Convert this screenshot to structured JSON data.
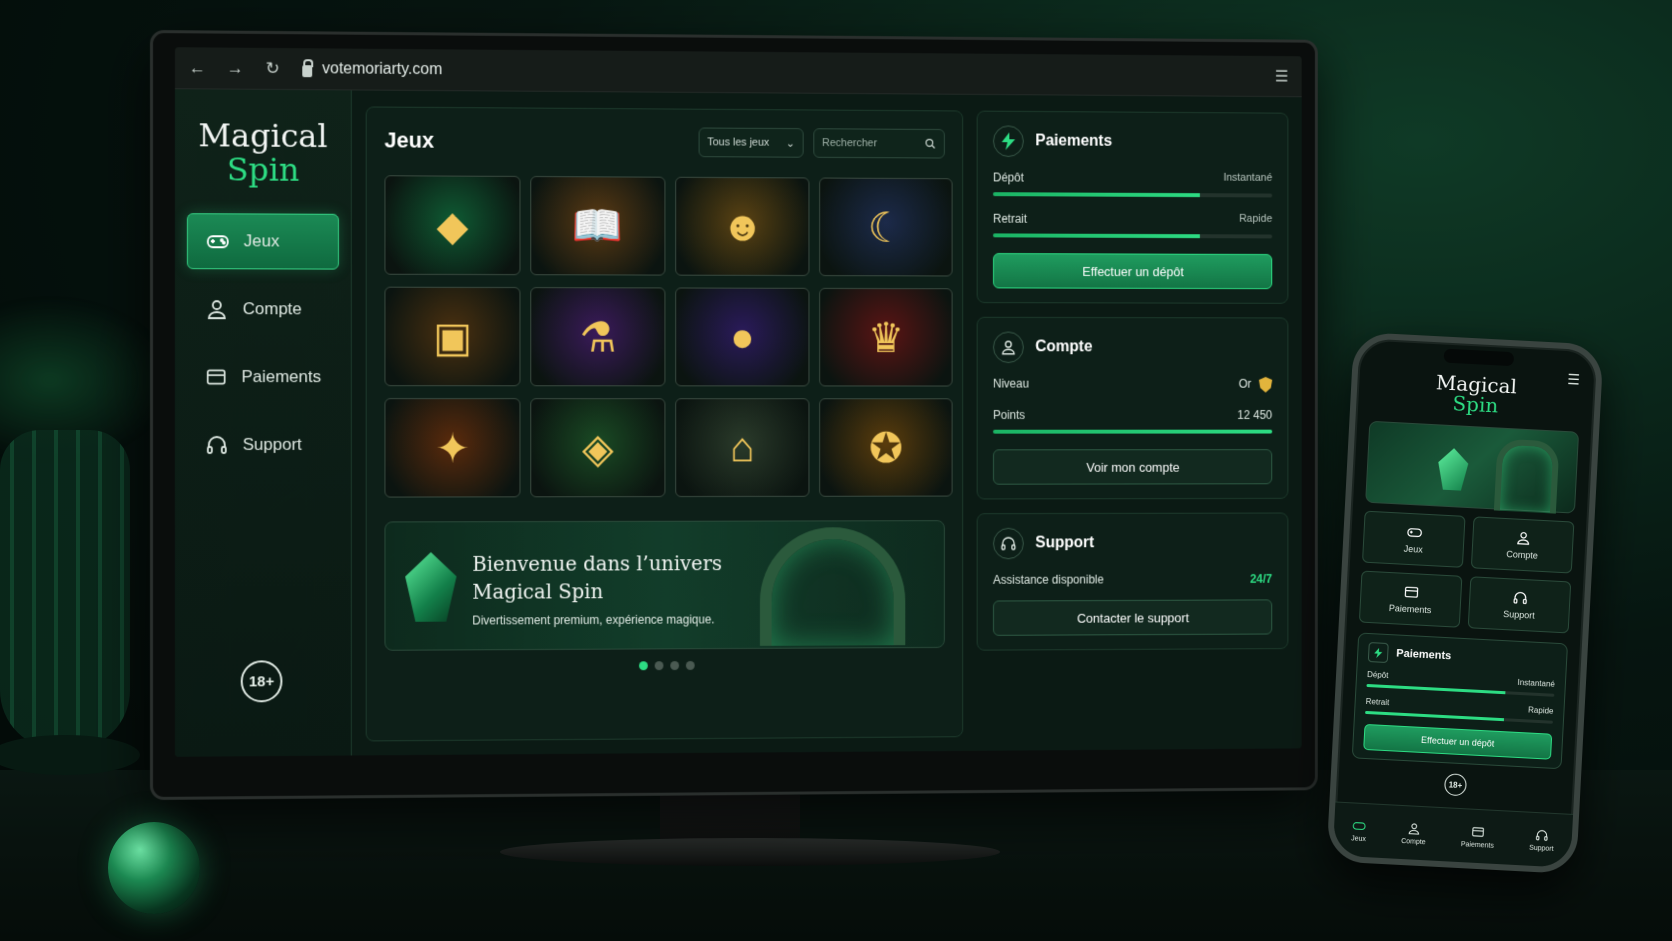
{
  "browser": {
    "url": "votemoriarty.com"
  },
  "logo": {
    "line1": "Magical",
    "line2": "Spin"
  },
  "sidebar": {
    "items": [
      {
        "label": "Jeux",
        "icon": "gamepad-icon",
        "active": true
      },
      {
        "label": "Compte",
        "icon": "user-icon",
        "active": false
      },
      {
        "label": "Paiements",
        "icon": "wallet-icon",
        "active": false
      },
      {
        "label": "Support",
        "icon": "headset-icon",
        "active": false
      }
    ],
    "age_badge": "18+"
  },
  "games": {
    "title": "Jeux",
    "filter_value": "Tous les jeux",
    "search_placeholder": "Rechercher",
    "tiles": [
      {
        "name": "emerald",
        "icon": "emerald-icon",
        "color": "#0f5a33"
      },
      {
        "name": "spellbook",
        "icon": "book-icon",
        "color": "#5a3a14"
      },
      {
        "name": "golden-mask",
        "icon": "mask-icon",
        "color": "#5a4212"
      },
      {
        "name": "wolf-moon",
        "icon": "wolf-icon",
        "color": "#1c2a4a"
      },
      {
        "name": "treasure-chest",
        "icon": "chest-icon",
        "color": "#4a3010"
      },
      {
        "name": "potion",
        "icon": "potion-icon",
        "color": "#3a1a5a"
      },
      {
        "name": "crystal-ball",
        "icon": "crystal-ball-icon",
        "color": "#2a1a5a"
      },
      {
        "name": "crown",
        "icon": "crown-icon",
        "color": "#5a1414"
      },
      {
        "name": "phoenix",
        "icon": "phoenix-icon",
        "color": "#5a2a0c"
      },
      {
        "name": "amulet",
        "icon": "amulet-icon",
        "color": "#1a4a24"
      },
      {
        "name": "temple",
        "icon": "temple-icon",
        "color": "#2a3a2a"
      },
      {
        "name": "gold-pile",
        "icon": "gold-icon",
        "color": "#5a3c0c"
      }
    ]
  },
  "banner": {
    "title_line1": "Bienvenue dans l’univers",
    "title_line2": "Magical Spin",
    "subtitle": "Divertissement premium, expérience magique.",
    "active_dot": 0,
    "dot_count": 4
  },
  "payments_card": {
    "title": "Paiements",
    "deposit_label": "Dépôt",
    "deposit_value": "Instantané",
    "deposit_progress": 0.74,
    "withdraw_label": "Retrait",
    "withdraw_value": "Rapide",
    "withdraw_progress": 0.74,
    "button": "Effectuer un dépôt"
  },
  "account_card": {
    "title": "Compte",
    "level_label": "Niveau",
    "level_value": "Or",
    "points_label": "Points",
    "points_value": "12 450",
    "points_progress": 1.0,
    "button": "Voir mon compte"
  },
  "support_card": {
    "title": "Support",
    "availability_label": "Assistance disponible",
    "availability_value": "24/7",
    "button": "Contacter le support"
  },
  "phone": {
    "logo_line1": "Magical",
    "logo_line2": "Spin",
    "tiles": [
      "Jeux",
      "Compte",
      "Paiements",
      "Support"
    ],
    "payments": {
      "title": "Paiements",
      "deposit_label": "Dépôt",
      "deposit_value": "Instantané",
      "withdraw_label": "Retrait",
      "withdraw_value": "Rapide",
      "button": "Effectuer un dépôt"
    },
    "age_badge": "18+",
    "tabbar": [
      "Jeux",
      "Compte",
      "Paiements",
      "Support"
    ]
  },
  "colors": {
    "accent": "#2ddc83",
    "panel": "#0d1f18",
    "gold": "#e3b43c"
  }
}
